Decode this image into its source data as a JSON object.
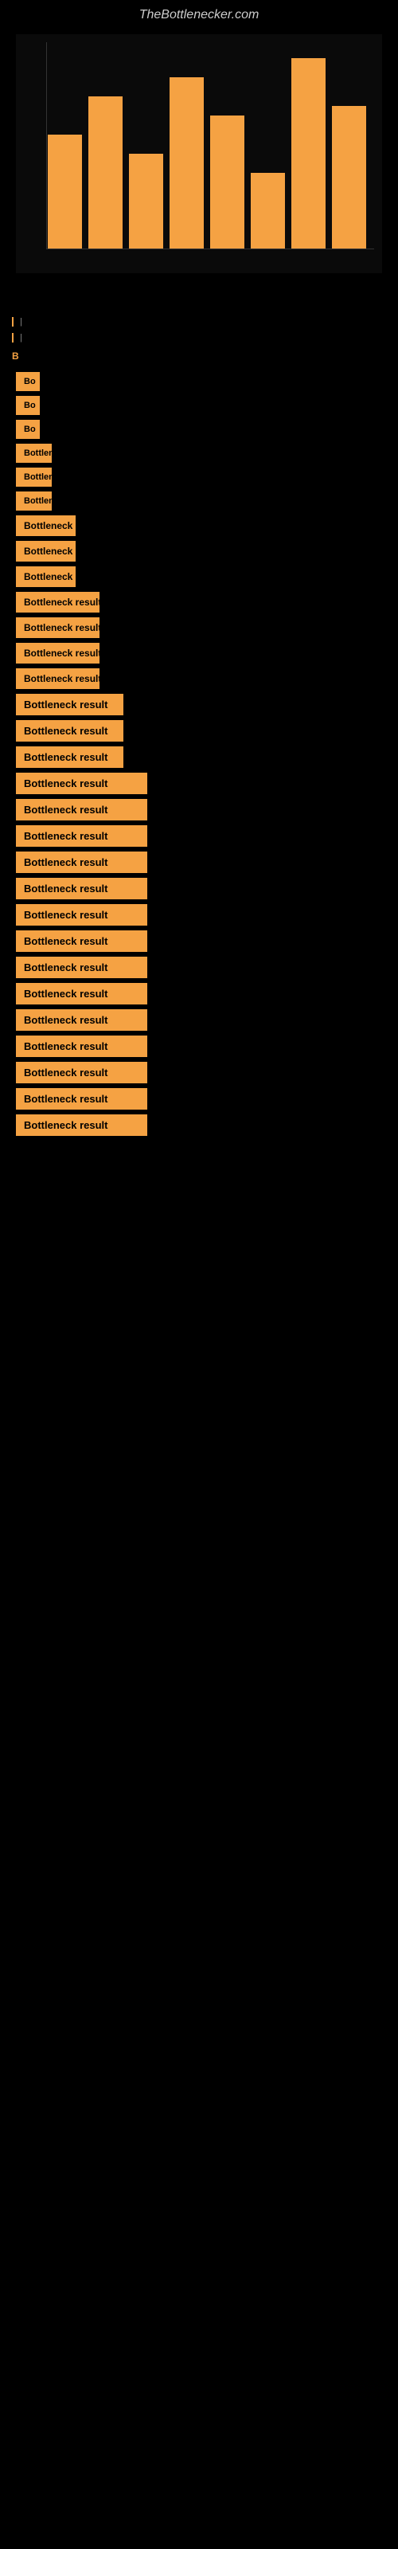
{
  "site": {
    "title": "TheBottlenecker.com"
  },
  "results": [
    {
      "id": 1,
      "label": "Bottleneck result",
      "size": "xs"
    },
    {
      "id": 2,
      "label": "Bottleneck result",
      "size": "xs"
    },
    {
      "id": 3,
      "label": "Bottleneck result",
      "size": "xs"
    },
    {
      "id": 4,
      "label": "Bottleneck result",
      "size": "sm"
    },
    {
      "id": 5,
      "label": "Bottleneck result",
      "size": "sm"
    },
    {
      "id": 6,
      "label": "Bottleneck result",
      "size": "sm"
    },
    {
      "id": 7,
      "label": "Bottleneck result",
      "size": "md"
    },
    {
      "id": 8,
      "label": "Bottleneck result",
      "size": "md"
    },
    {
      "id": 9,
      "label": "Bottleneck result",
      "size": "md"
    },
    {
      "id": 10,
      "label": "Bottleneck result",
      "size": "lg"
    },
    {
      "id": 11,
      "label": "Bottleneck result",
      "size": "lg"
    },
    {
      "id": 12,
      "label": "Bottleneck result",
      "size": "lg"
    },
    {
      "id": 13,
      "label": "Bottleneck result",
      "size": "lg"
    },
    {
      "id": 14,
      "label": "Bottleneck result",
      "size": "xl"
    },
    {
      "id": 15,
      "label": "Bottleneck result",
      "size": "xl"
    },
    {
      "id": 16,
      "label": "Bottleneck result",
      "size": "xl"
    },
    {
      "id": 17,
      "label": "Bottleneck result",
      "size": "full"
    },
    {
      "id": 18,
      "label": "Bottleneck result",
      "size": "full"
    },
    {
      "id": 19,
      "label": "Bottleneck result",
      "size": "full"
    },
    {
      "id": 20,
      "label": "Bottleneck result",
      "size": "full"
    },
    {
      "id": 21,
      "label": "Bottleneck result",
      "size": "full"
    },
    {
      "id": 22,
      "label": "Bottleneck result",
      "size": "full"
    },
    {
      "id": 23,
      "label": "Bottleneck result",
      "size": "full"
    },
    {
      "id": 24,
      "label": "Bottleneck result",
      "size": "full"
    },
    {
      "id": 25,
      "label": "Bottleneck result",
      "size": "full"
    },
    {
      "id": 26,
      "label": "Bottleneck result",
      "size": "full"
    },
    {
      "id": 27,
      "label": "Bottleneck result",
      "size": "full"
    },
    {
      "id": 28,
      "label": "Bottleneck result",
      "size": "full"
    },
    {
      "id": 29,
      "label": "Bottleneck result",
      "size": "full"
    },
    {
      "id": 30,
      "label": "Bottleneck result",
      "size": "full"
    }
  ],
  "colors": {
    "accent": "#f5a243",
    "bg": "#000000",
    "text": "#ffffff"
  }
}
